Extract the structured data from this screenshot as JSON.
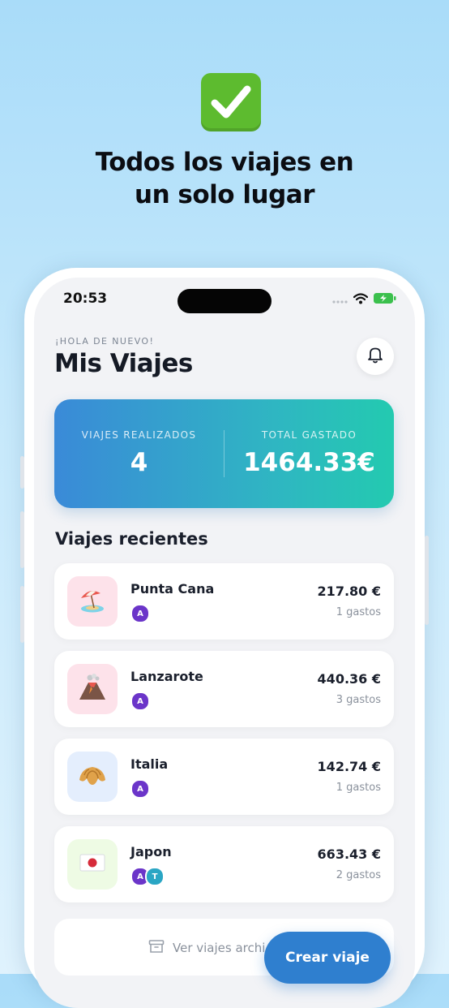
{
  "hero": {
    "icon": "check-mark-icon",
    "title_line1": "Todos los viajes en",
    "title_line2": "un solo lugar"
  },
  "status_bar": {
    "time": "20:53",
    "icons": [
      "signal-icon",
      "wifi-icon",
      "battery-charging-icon"
    ]
  },
  "header": {
    "greeting": "¡HOLA DE NUEVO!",
    "title": "Mis Viajes",
    "notification_icon": "bell-icon"
  },
  "stats": {
    "trips_label": "VIAJES REALIZADOS",
    "trips_value": "4",
    "spent_label": "TOTAL GASTADO",
    "spent_value": "1464.33€"
  },
  "recent": {
    "title": "Viajes recientes",
    "trips": [
      {
        "name": "Punta Cana",
        "amount": "217.80 €",
        "count": "1 gastos",
        "icon": "beach-umbrella-icon",
        "thumb_color": "#fde2ea",
        "avatars": [
          "A"
        ]
      },
      {
        "name": "Lanzarote",
        "amount": "440.36 €",
        "count": "3 gastos",
        "icon": "volcano-icon",
        "thumb_color": "#fde2ea",
        "avatars": [
          "A"
        ]
      },
      {
        "name": "Italia",
        "amount": "142.74 €",
        "count": "1 gastos",
        "icon": "croissant-icon",
        "thumb_color": "#e4eefd",
        "avatars": [
          "A"
        ]
      },
      {
        "name": "Japon",
        "amount": "663.43 €",
        "count": "2 gastos",
        "icon": "japan-flag-icon",
        "thumb_color": "#eefbe4",
        "avatars": [
          "A",
          "T"
        ]
      }
    ]
  },
  "archive": {
    "label": "Ver viajes archi",
    "icon": "archive-box-icon"
  },
  "create_button": {
    "label": "Crear viaje"
  },
  "colors": {
    "avatar_a": "#6b35c9",
    "avatar_t": "#2aa6c4",
    "stats_gradient_start": "#3a8ad8",
    "stats_gradient_end": "#23cab0",
    "create_button": "#2f7fcf"
  }
}
